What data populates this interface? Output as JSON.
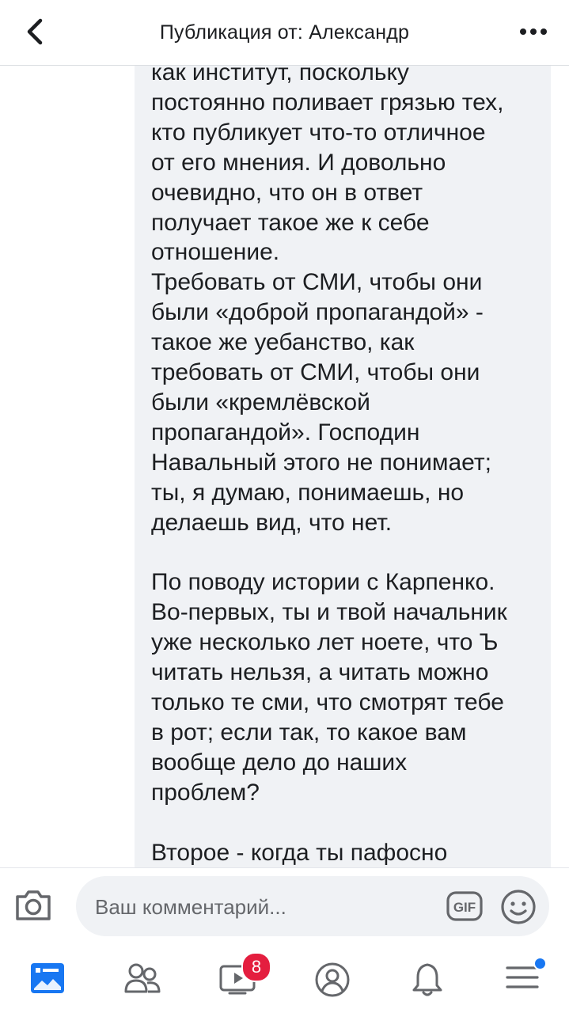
{
  "header": {
    "title": "Публикация от: Александр"
  },
  "comment": {
    "paragraphs": [
      "как институт, поскольку\nпостоянно поливает грязью тех,\nкто публикует что-то отличное\nот его мнения. И довольно\nочевидно, что он в ответ\nполучает такое же к себе\nотношение.\nТребовать от СМИ, чтобы они\nбыли «доброй пропагандой» -\nтакое же уебанство, как\nтребовать от СМИ, чтобы они\nбыли «кремлёвской\nпропагандой». Господин\nНавальный этого не понимает;\nты, я думаю, понимаешь, но\nделаешь вид, что нет.",
      "По поводу истории с Карпенко.\nВо-первых, ты и твой начальник\nуже несколько лет ноете, что Ъ\nчитать нельзя, а читать можно\nтолько те сми, что смотрят тебе\nв рот; если так, то какое вам\nвообще дело до наших\nпроблем?",
      "Второе - когда ты пафосно"
    ]
  },
  "composer": {
    "placeholder": "Ваш комментарий...",
    "gif_label": "GIF"
  },
  "tabs": {
    "items": [
      "news-feed",
      "friends",
      "watch",
      "profile",
      "notifications",
      "menu"
    ],
    "watch_badge": "8"
  },
  "colors": {
    "accent": "#1877f2",
    "icon": "#65676b",
    "badge": "#e41e3f",
    "bubble": "#f0f2f5"
  }
}
